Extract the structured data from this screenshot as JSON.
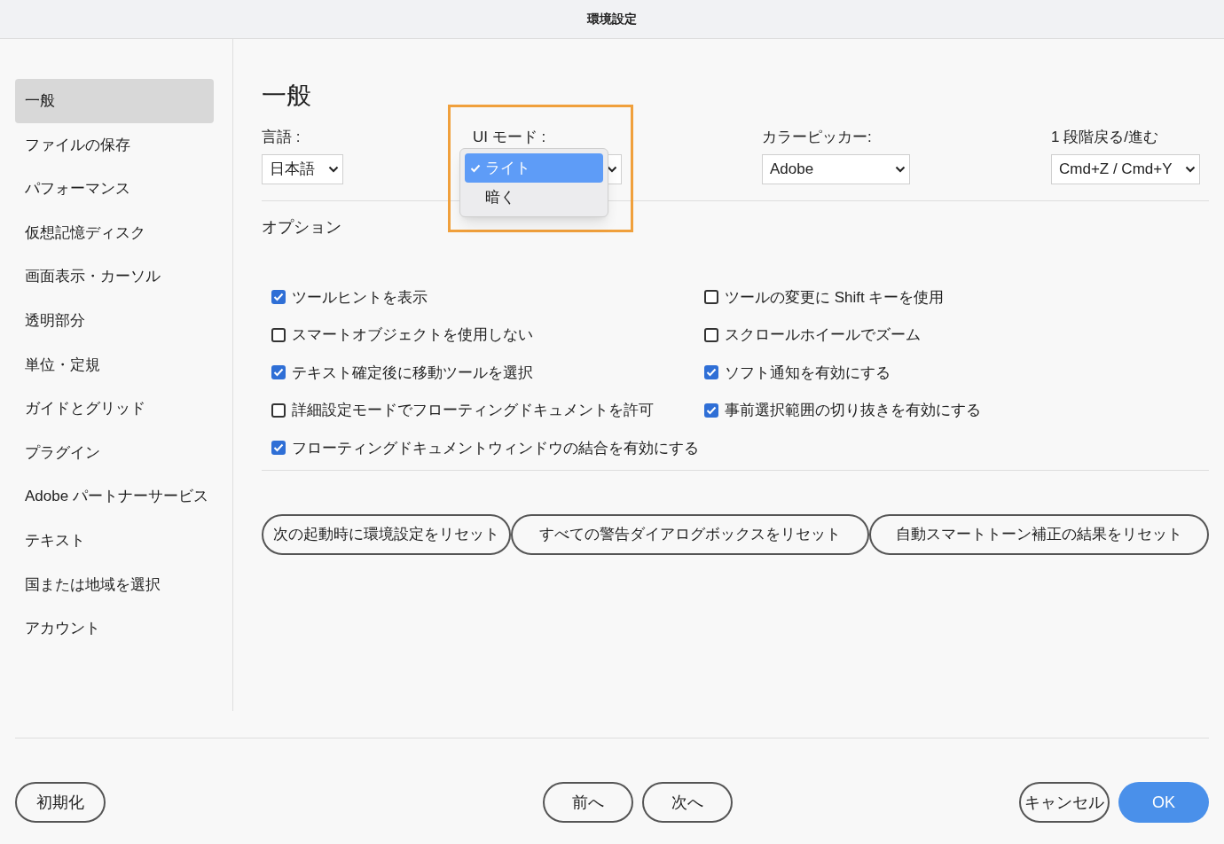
{
  "window": {
    "title": "環境設定"
  },
  "sidebar": {
    "items": [
      {
        "label": "一般",
        "selected": true
      },
      {
        "label": "ファイルの保存",
        "selected": false
      },
      {
        "label": "パフォーマンス",
        "selected": false
      },
      {
        "label": "仮想記憶ディスク",
        "selected": false
      },
      {
        "label": "画面表示・カーソル",
        "selected": false
      },
      {
        "label": "透明部分",
        "selected": false
      },
      {
        "label": "単位・定規",
        "selected": false
      },
      {
        "label": "ガイドとグリッド",
        "selected": false
      },
      {
        "label": "プラグイン",
        "selected": false
      },
      {
        "label": "Adobe パートナーサービス",
        "selected": false
      },
      {
        "label": "テキスト",
        "selected": false
      },
      {
        "label": "国または地域を選択",
        "selected": false
      },
      {
        "label": "アカウント",
        "selected": false
      }
    ]
  },
  "heading": "一般",
  "selects": [
    {
      "label": "言語 :",
      "value": "日本語"
    },
    {
      "label": "UI モード :",
      "menu": [
        {
          "label": "ライト",
          "selected": true
        },
        {
          "label": "暗く",
          "selected": false
        }
      ]
    },
    {
      "label": "カラーピッカー:",
      "value": "Adobe"
    },
    {
      "label": "1 段階戻る/進む",
      "value": "Cmd+Z / Cmd+Y"
    }
  ],
  "options_title": "オプション",
  "options_left": [
    {
      "label": "ツールヒントを表示",
      "checked": true
    },
    {
      "label": "スマートオブジェクトを使用しない",
      "checked": false
    },
    {
      "label": "テキスト確定後に移動ツールを選択",
      "checked": true
    },
    {
      "label": "詳細設定モードでフローティングドキュメントを許可",
      "checked": false
    },
    {
      "label": "フローティングドキュメントウィンドウの結合を有効にする",
      "checked": true
    }
  ],
  "options_right": [
    {
      "label": "ツールの変更に Shift キーを使用",
      "checked": false
    },
    {
      "label": "スクロールホイールでズーム",
      "checked": false
    },
    {
      "label": "ソフト通知を有効にする",
      "checked": true
    },
    {
      "label": "事前選択範囲の切り抜きを有効にする",
      "checked": true
    }
  ],
  "reset_buttons": [
    "次の起動時に環境設定をリセット",
    "すべての警告ダイアログボックスをリセット",
    "自動スマートトーン補正の結果をリセット"
  ],
  "footer": {
    "reset": "初期化",
    "prev": "前へ",
    "next": "次へ",
    "cancel": "キャンセル",
    "ok": "OK"
  }
}
